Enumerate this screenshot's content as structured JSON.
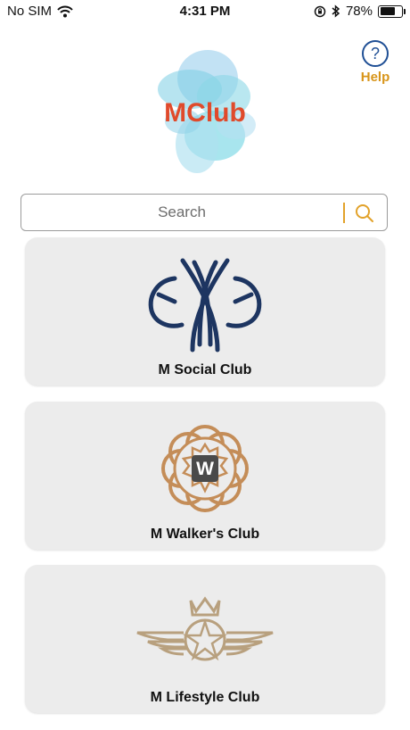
{
  "status_bar": {
    "carrier": "No SIM",
    "time": "4:31 PM",
    "battery": "78%",
    "battery_level": 0.78
  },
  "header": {
    "logo_text": "MClub",
    "help_label": "Help",
    "help_symbol": "?"
  },
  "search": {
    "placeholder": "Search"
  },
  "clubs": [
    {
      "name": "M Social Club"
    },
    {
      "name": "M Walker's Club"
    },
    {
      "name": "M Lifestyle Club"
    }
  ],
  "colors": {
    "accent": "#d8951a",
    "help_blue": "#1f4f95",
    "card_bg": "#ececec",
    "social_navy": "#1d3561",
    "walker_tan": "#c48d58",
    "lifestyle_gold": "#b8a07e"
  }
}
